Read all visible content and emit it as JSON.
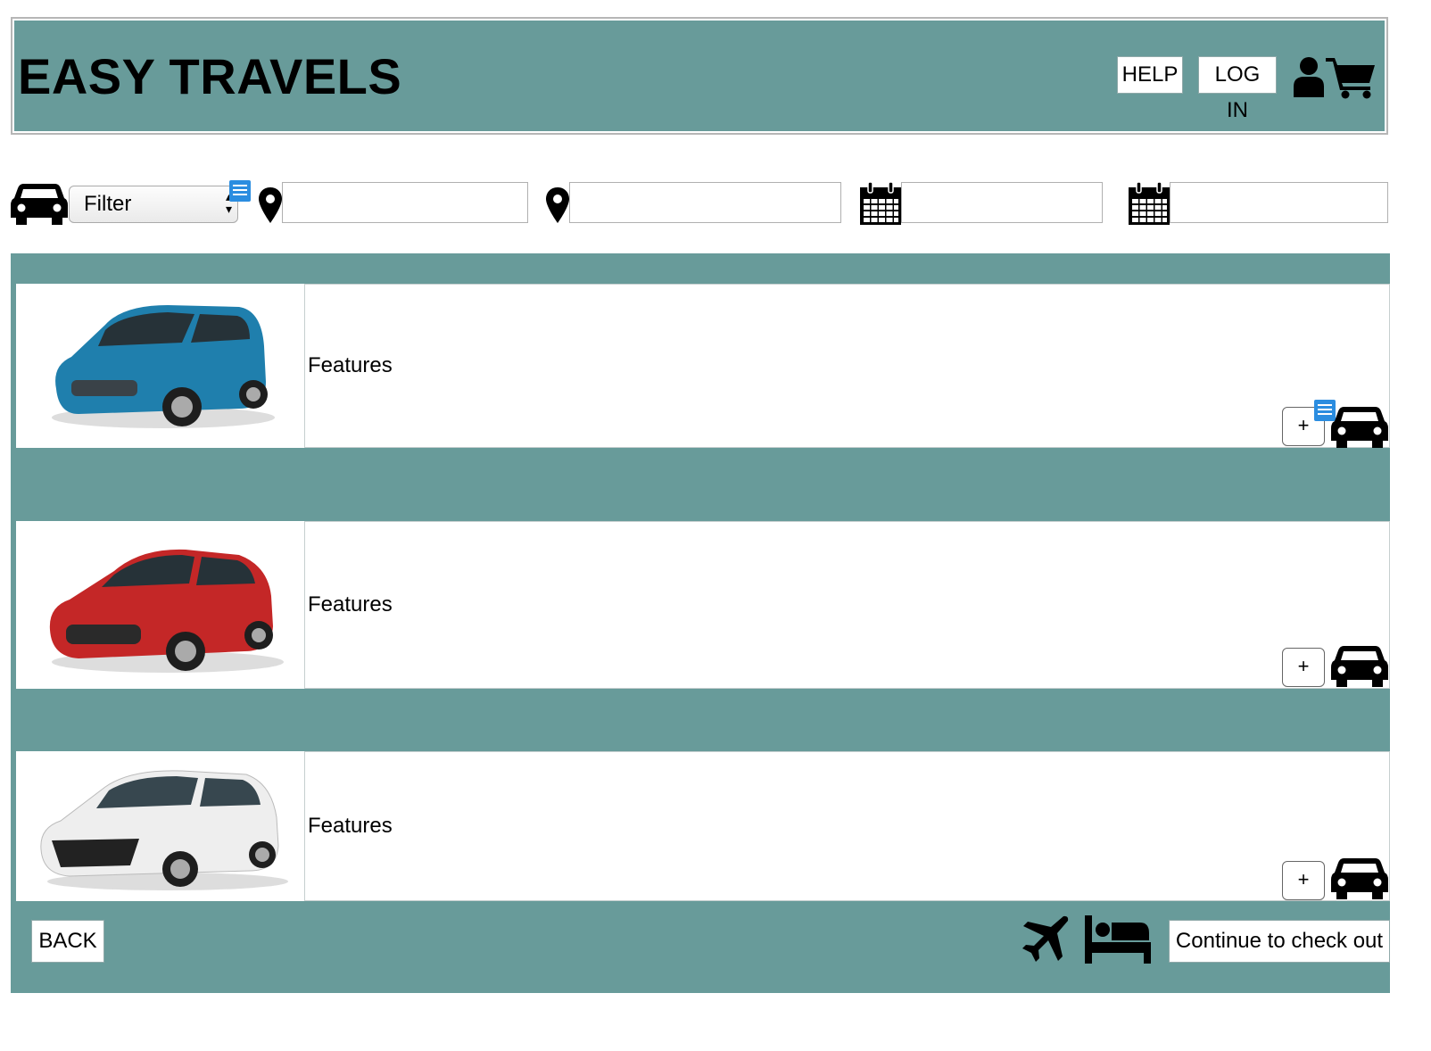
{
  "header": {
    "title": "EASY TRAVELS",
    "help_label": "HELP",
    "login_label": "LOG IN",
    "icons": [
      "user-icon",
      "shopping-cart-icon"
    ],
    "background_color": "#689b9a"
  },
  "search": {
    "type_icon": "car-icon",
    "filter_label": "Filter",
    "pickup_location": "",
    "dropoff_location": "",
    "pickup_date": "",
    "dropoff_date": "",
    "icons": [
      "map-pin-icon",
      "map-pin-icon",
      "calendar-icon",
      "calendar-icon"
    ]
  },
  "results": {
    "cars": [
      {
        "features_label": "Features",
        "color": "#1f7fad",
        "add_label": "+"
      },
      {
        "features_label": "Features",
        "color": "#c42727",
        "add_label": "+"
      },
      {
        "features_label": "Features",
        "color": "#eeeeee",
        "add_label": "+"
      }
    ]
  },
  "footer": {
    "back_label": "BACK",
    "checkout_label": "Continue to check out",
    "icons": [
      "airplane-icon",
      "bed-icon"
    ]
  }
}
